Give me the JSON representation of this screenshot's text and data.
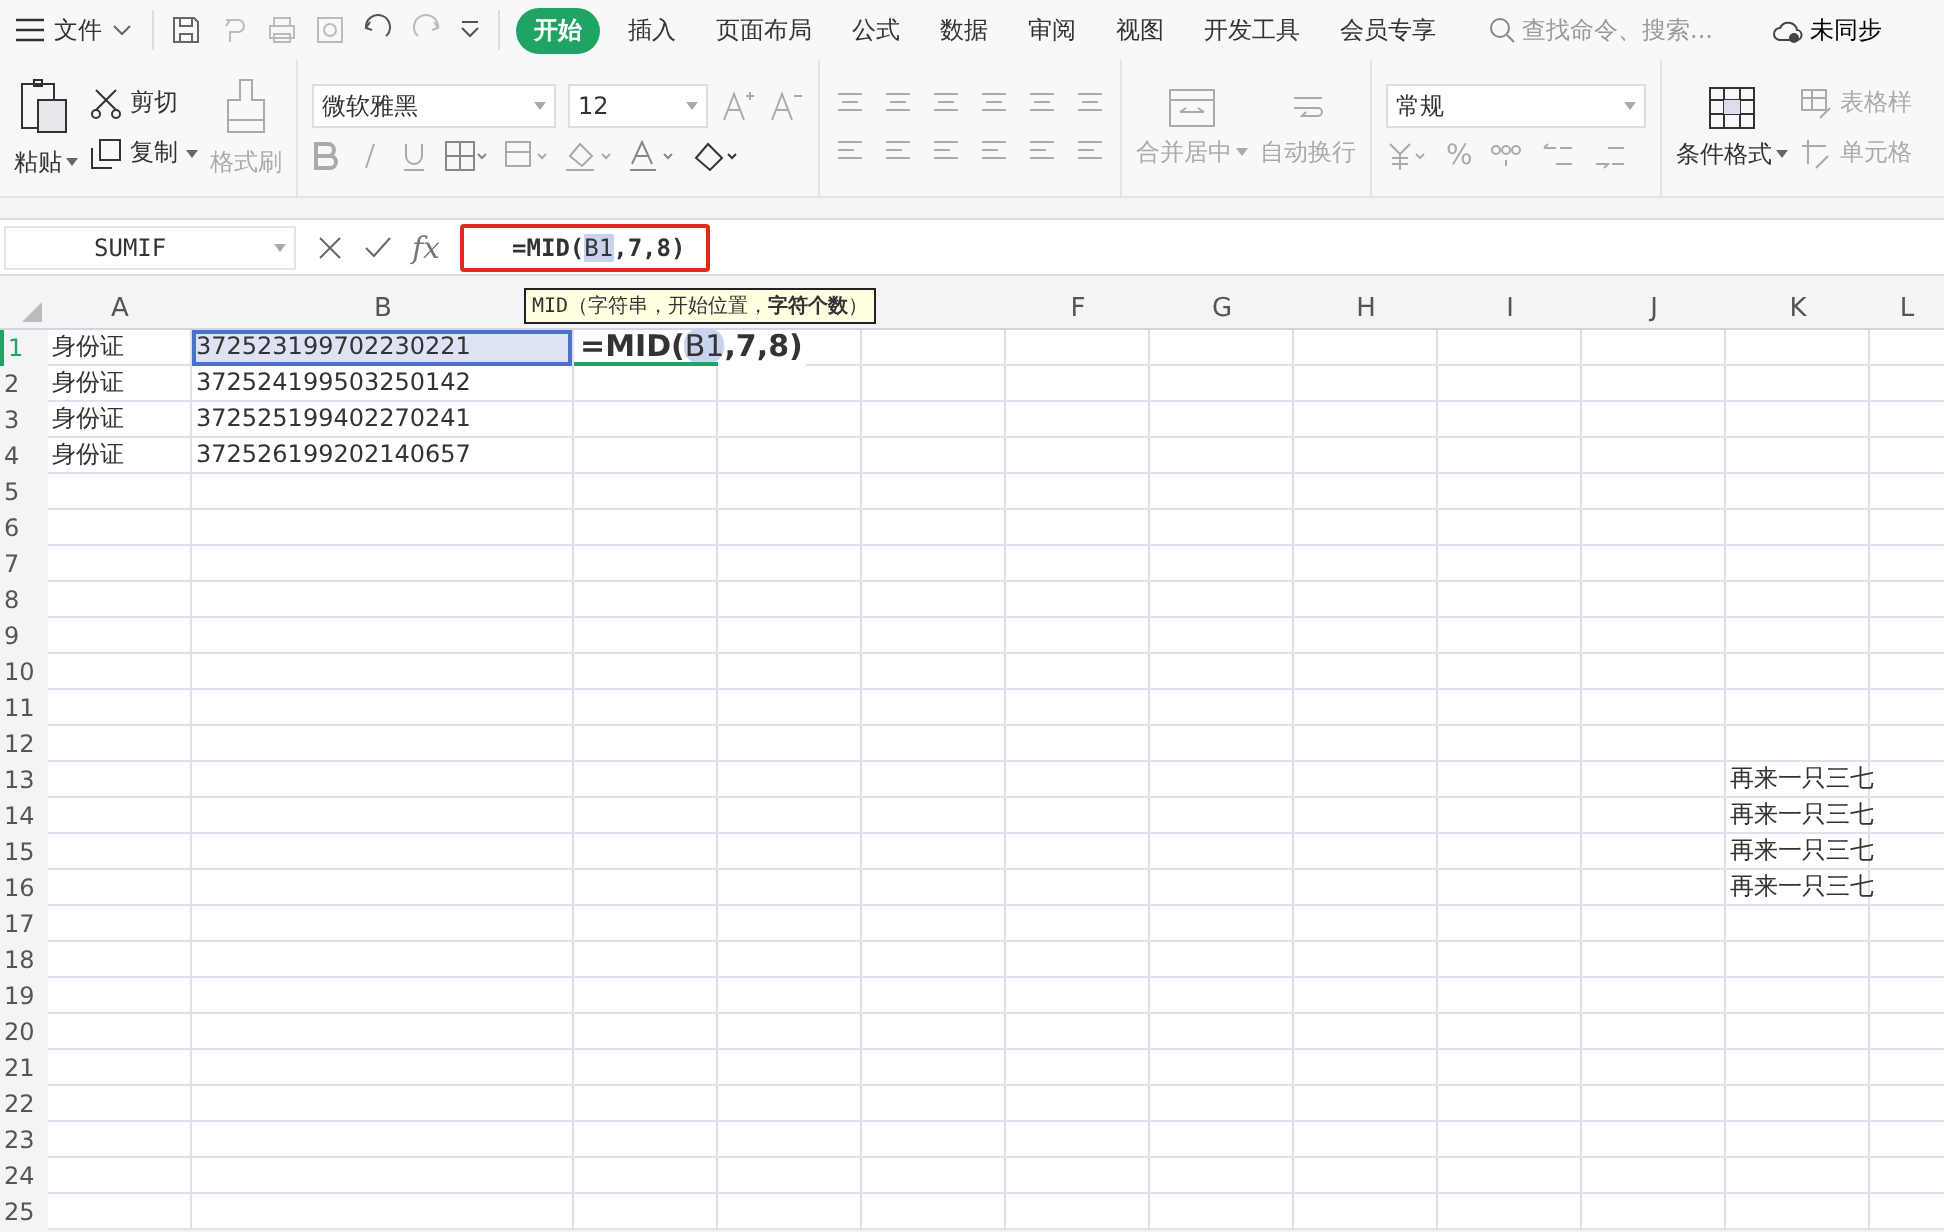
{
  "menu": {
    "file_label": "文件",
    "tabs": [
      {
        "label": "开始",
        "selected": true
      },
      {
        "label": "插入",
        "selected": false
      },
      {
        "label": "页面布局",
        "selected": false
      },
      {
        "label": "公式",
        "selected": false
      },
      {
        "label": "数据",
        "selected": false
      },
      {
        "label": "审阅",
        "selected": false
      },
      {
        "label": "视图",
        "selected": false
      },
      {
        "label": "开发工具",
        "selected": false
      },
      {
        "label": "会员专享",
        "selected": false
      }
    ],
    "search": {
      "placeholder": "查找命令、搜索..."
    },
    "sync_label": "未同步"
  },
  "ribbon": {
    "paste": {
      "label": "粘贴",
      "disabled": false
    },
    "cut": {
      "label": "剪切",
      "disabled": false
    },
    "copy": {
      "label": "复制",
      "disabled": false
    },
    "format_painter": {
      "label": "格式刷",
      "disabled": true
    },
    "font": {
      "value": "微软雅黑"
    },
    "font_size": {
      "value": "12"
    },
    "merge": {
      "label": "合并居中",
      "disabled": true
    },
    "wrap": {
      "label": "自动换行",
      "disabled": true
    },
    "number_format": {
      "value": "常规"
    },
    "percent": {
      "label": "%",
      "disabled": true
    },
    "conditional": {
      "label": "条件格式",
      "disabled": false
    },
    "table_style": {
      "label": "表格样",
      "disabled": true
    },
    "cell_style": {
      "label": "单元格",
      "disabled": true
    }
  },
  "formula_bar": {
    "name_box": "SUMIF",
    "fx_label": "fx",
    "formula": {
      "prefix": "=MID(",
      "ref": "B1",
      "suffix": ",7,8)"
    }
  },
  "tooltip": "MID（字符串，开始位置，**字符个数**）",
  "grid": {
    "columns": [
      "A",
      "B",
      null,
      null,
      null,
      "F",
      "G",
      "H",
      "I",
      "J",
      "K",
      "L"
    ],
    "rows": [
      {
        "label": "1",
        "selected": true,
        "cells": {
          "A": {
            "text": "身份证"
          },
          "B": {
            "text": "372523199702230221",
            "highlighted": true
          },
          "C": {
            "kind": "editor",
            "prefix": "=MID(",
            "ref": "B1",
            "suffix": ",7,8)"
          }
        }
      },
      {
        "label": "2",
        "selected": false,
        "cells": {
          "A": {
            "text": "身份证"
          },
          "B": {
            "text": "372524199503250142"
          }
        }
      },
      {
        "label": "3",
        "selected": false,
        "cells": {
          "A": {
            "text": "身份证"
          },
          "B": {
            "text": "372525199402270241"
          }
        }
      },
      {
        "label": "4",
        "selected": false,
        "cells": {
          "A": {
            "text": "身份证"
          },
          "B": {
            "text": "372526199202140657"
          }
        }
      },
      {
        "label": "5",
        "selected": false,
        "cells": {}
      },
      {
        "label": "6",
        "selected": false,
        "cells": {}
      },
      {
        "label": "7",
        "selected": false,
        "cells": {}
      },
      {
        "label": "8",
        "selected": false,
        "cells": {}
      },
      {
        "label": "9",
        "selected": false,
        "cells": {}
      },
      {
        "label": "10",
        "selected": false,
        "cells": {}
      },
      {
        "label": "11",
        "selected": false,
        "cells": {}
      },
      {
        "label": "12",
        "selected": false,
        "cells": {}
      },
      {
        "label": "13",
        "selected": false,
        "cells": {
          "K": {
            "text": "再来一只三七"
          }
        }
      },
      {
        "label": "14",
        "selected": false,
        "cells": {
          "K": {
            "text": "再来一只三七"
          }
        }
      },
      {
        "label": "15",
        "selected": false,
        "cells": {
          "K": {
            "text": "再来一只三七"
          }
        }
      },
      {
        "label": "16",
        "selected": false,
        "cells": {
          "K": {
            "text": "再来一只三七"
          }
        }
      },
      {
        "label": "17",
        "selected": false,
        "cells": {}
      },
      {
        "label": "18",
        "selected": false,
        "cells": {}
      },
      {
        "label": "19",
        "selected": false,
        "cells": {}
      },
      {
        "label": "20",
        "selected": false,
        "cells": {}
      },
      {
        "label": "21",
        "selected": false,
        "cells": {}
      },
      {
        "label": "22",
        "selected": false,
        "cells": {}
      },
      {
        "label": "23",
        "selected": false,
        "cells": {}
      },
      {
        "label": "24",
        "selected": false,
        "cells": {}
      },
      {
        "label": "25",
        "selected": false,
        "cells": {}
      }
    ]
  }
}
